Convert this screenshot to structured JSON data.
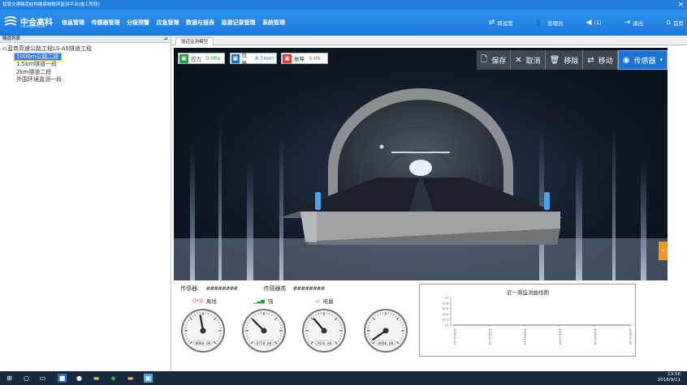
{
  "window": {
    "title": "智慧交通隧道结构健康物联网监测平台[施工阶段]"
  },
  "brand": {
    "name": "中金高科",
    "sub": "ZHONGJIN GAOKE"
  },
  "nav": [
    "信息管理",
    "传感器管理",
    "分级预警",
    "应急管理",
    "数据与报表",
    "监测记录管理",
    "系统管理"
  ],
  "header_actions": [
    {
      "icon": "transfer-icon",
      "glyph": "⇄",
      "label": "转运营"
    },
    {
      "icon": "user-icon",
      "glyph": "👥",
      "label": "管理员"
    },
    {
      "icon": "speaker-icon",
      "glyph": "◀",
      "label": "(1)"
    },
    {
      "icon": "logout-icon",
      "glyph": "⇥",
      "label": "退出"
    },
    {
      "icon": "home-icon",
      "glyph": "⌂",
      "label": "首页"
    }
  ],
  "left_panel": {
    "title": "隧道列表",
    "root": "蓝商高速公路工程LS-A5隧道工程",
    "children": [
      "1000m公路二段",
      "1.5km隧道一段",
      "2km隧道二段",
      "外围环境监测一段"
    ],
    "selected_index": 0
  },
  "main_tab": "隧道监测模型",
  "metrics": [
    {
      "icon": "pressure-icon",
      "label": "应力",
      "value": "0.0Pa",
      "color": "#1aa52f"
    },
    {
      "icon": "displacement-icon",
      "label": "位移",
      "value": "8.7mm",
      "color": "#1b73d6"
    },
    {
      "icon": "fault-icon",
      "label": "故障",
      "value": "3.0S",
      "color": "#d83b2e"
    }
  ],
  "toolbar": [
    {
      "icon": "save-icon",
      "glyph": "🗋",
      "label": "保存"
    },
    {
      "icon": "cancel-icon",
      "glyph": "✕",
      "label": "取消"
    },
    {
      "icon": "trash-icon",
      "glyph": "🗑",
      "label": "移除"
    },
    {
      "icon": "move-icon",
      "glyph": "⇄",
      "label": "移动"
    },
    {
      "icon": "sensor-icon",
      "glyph": "◉",
      "label": "传感器",
      "caret": "▾"
    }
  ],
  "side_tab": "«",
  "sensor": {
    "sensor_label": "传感器:",
    "sensor_value": "########",
    "type_label": "传感器类",
    "type_value": "########"
  },
  "status": [
    {
      "icon": "signal-broadcast-icon",
      "glyph": "((•))",
      "label": "离线",
      "color": "#d83b2e"
    },
    {
      "icon": "signal-bars-icon",
      "glyph": "▁▃▅",
      "label": "强",
      "color": "#1aa52f"
    },
    {
      "icon": "battery-icon",
      "glyph": "▭",
      "label": "电量",
      "color": "#d83b2e"
    }
  ],
  "gauges": [
    {
      "readout": "0000.00",
      "needle_deg": -10
    },
    {
      "readout": "0750.00",
      "needle_deg": -45
    },
    {
      "readout": "2010.00",
      "needle_deg": -40
    },
    {
      "readout": "0000.00",
      "needle_deg": -125
    }
  ],
  "chart_data": {
    "type": "line",
    "title": "近一周监测曲线图",
    "y_ticks": [
      "10",
      "10.8",
      "10.6",
      "10.4",
      "10.2",
      "10"
    ],
    "x_ticks": [
      "2018-02-01",
      "2018-02-02",
      "2018-02-03",
      "2018-02-04",
      "2018-02-05",
      "2018-02-06"
    ],
    "series": [
      {
        "values": [
          10,
          10,
          10,
          10,
          10,
          10
        ]
      }
    ]
  },
  "taskbar": {
    "time": "13:56",
    "date": "2018/9/11"
  }
}
